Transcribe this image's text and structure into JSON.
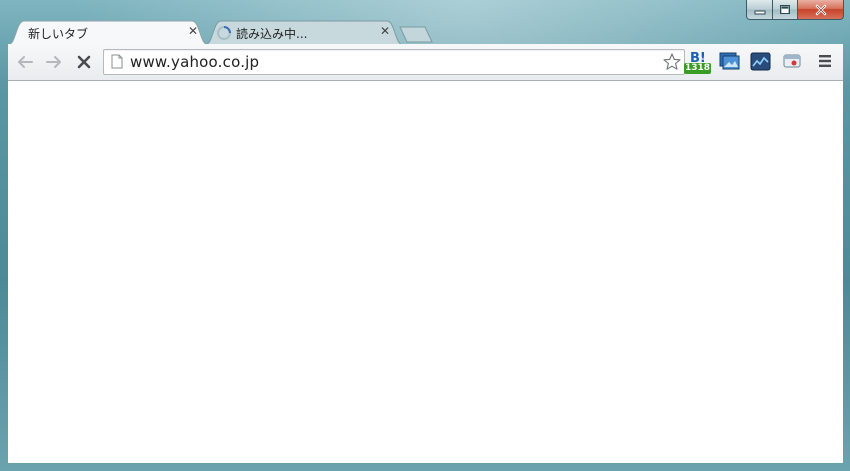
{
  "window": {
    "controls": [
      "minimize",
      "maximize",
      "close"
    ]
  },
  "tabs": [
    {
      "title": "新しいタブ",
      "active": true,
      "loading": false
    },
    {
      "title": "読み込み中...",
      "active": false,
      "loading": true
    }
  ],
  "toolbar": {
    "url": "www.yahoo.co.jp",
    "hatena_bookmark": {
      "label": "B!",
      "count": "1318"
    }
  },
  "icons": [
    "back-arrow-icon",
    "forward-arrow-icon",
    "stop-icon",
    "page-icon",
    "star-icon",
    "hatena-bookmark-icon",
    "screen-capture-icon",
    "chart-icon",
    "stamp-icon",
    "menu-icon",
    "close-icon",
    "minimize-icon",
    "maximize-icon",
    "loading-spinner-icon"
  ],
  "colors": {
    "frame": "#5a97a4",
    "close_button": "#c7432a",
    "hatena_badge": "#3a9d23",
    "hatena_text": "#1d5fb4"
  }
}
